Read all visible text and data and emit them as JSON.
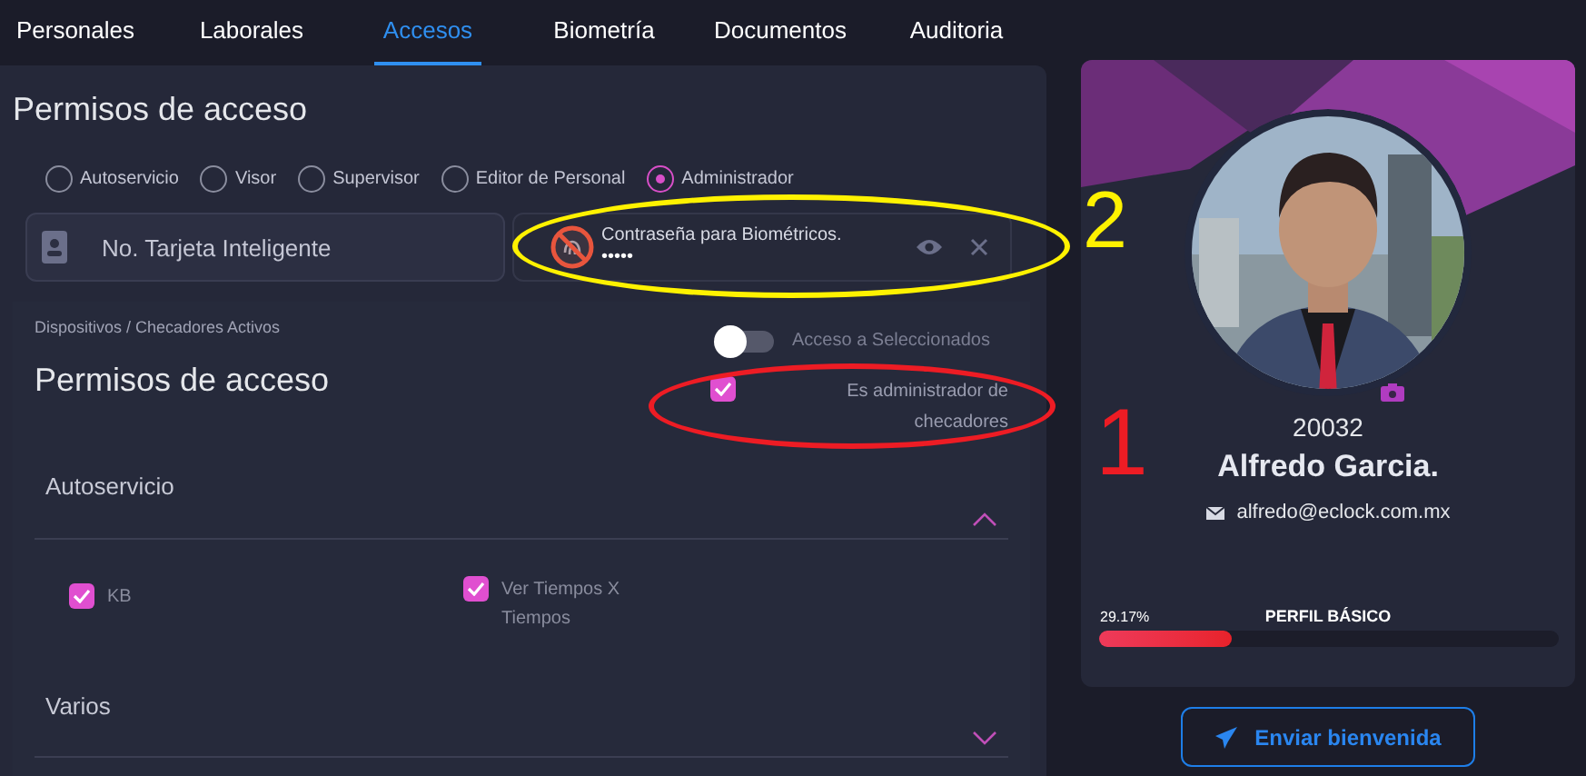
{
  "tabs": [
    {
      "label": "Personales",
      "selected": false
    },
    {
      "label": "Laborales",
      "selected": false
    },
    {
      "label": "Accesos",
      "selected": true
    },
    {
      "label": "Biometría",
      "selected": false
    },
    {
      "label": "Documentos",
      "selected": false
    },
    {
      "label": "Auditoria",
      "selected": false
    }
  ],
  "access": {
    "title": "Permisos de acceso",
    "roles": [
      {
        "label": "Autoservicio",
        "selected": false
      },
      {
        "label": "Visor",
        "selected": false
      },
      {
        "label": "Supervisor",
        "selected": false
      },
      {
        "label": "Editor de Personal",
        "selected": false
      },
      {
        "label": "Administrador",
        "selected": true
      }
    ],
    "card_field": {
      "placeholder": "No. Tarjeta Inteligente"
    },
    "password_field": {
      "label": "Contraseña para Biométricos.",
      "value": "•••••"
    }
  },
  "devices": {
    "caption": "Dispositivos / Checadores Activos",
    "title": "Permisos de acceso",
    "toggle": {
      "label": "Acceso a Seleccionados",
      "on": false
    },
    "admin_check": {
      "label": "Es administrador de checadores",
      "checked": true
    },
    "sections": [
      {
        "title": "Autoservicio",
        "expanded": true,
        "options": [
          {
            "label": "KB",
            "checked": true
          },
          {
            "label": "Ver Tiempos X Tiempos",
            "checked": true
          }
        ]
      },
      {
        "title": "Varios",
        "expanded": false
      }
    ]
  },
  "profile": {
    "number": "20032",
    "name": "Alfredo Garcia.",
    "email": "alfredo@eclock.com.mx",
    "progress": {
      "reading": "29.17%",
      "label": "PERFIL BÁSICO",
      "level": 0.2917
    },
    "button": "Enviar bienvenida"
  },
  "annotations": [
    {
      "label": "2",
      "color": "#fff200"
    },
    {
      "label": "1",
      "color": "#ed1c24"
    }
  ]
}
